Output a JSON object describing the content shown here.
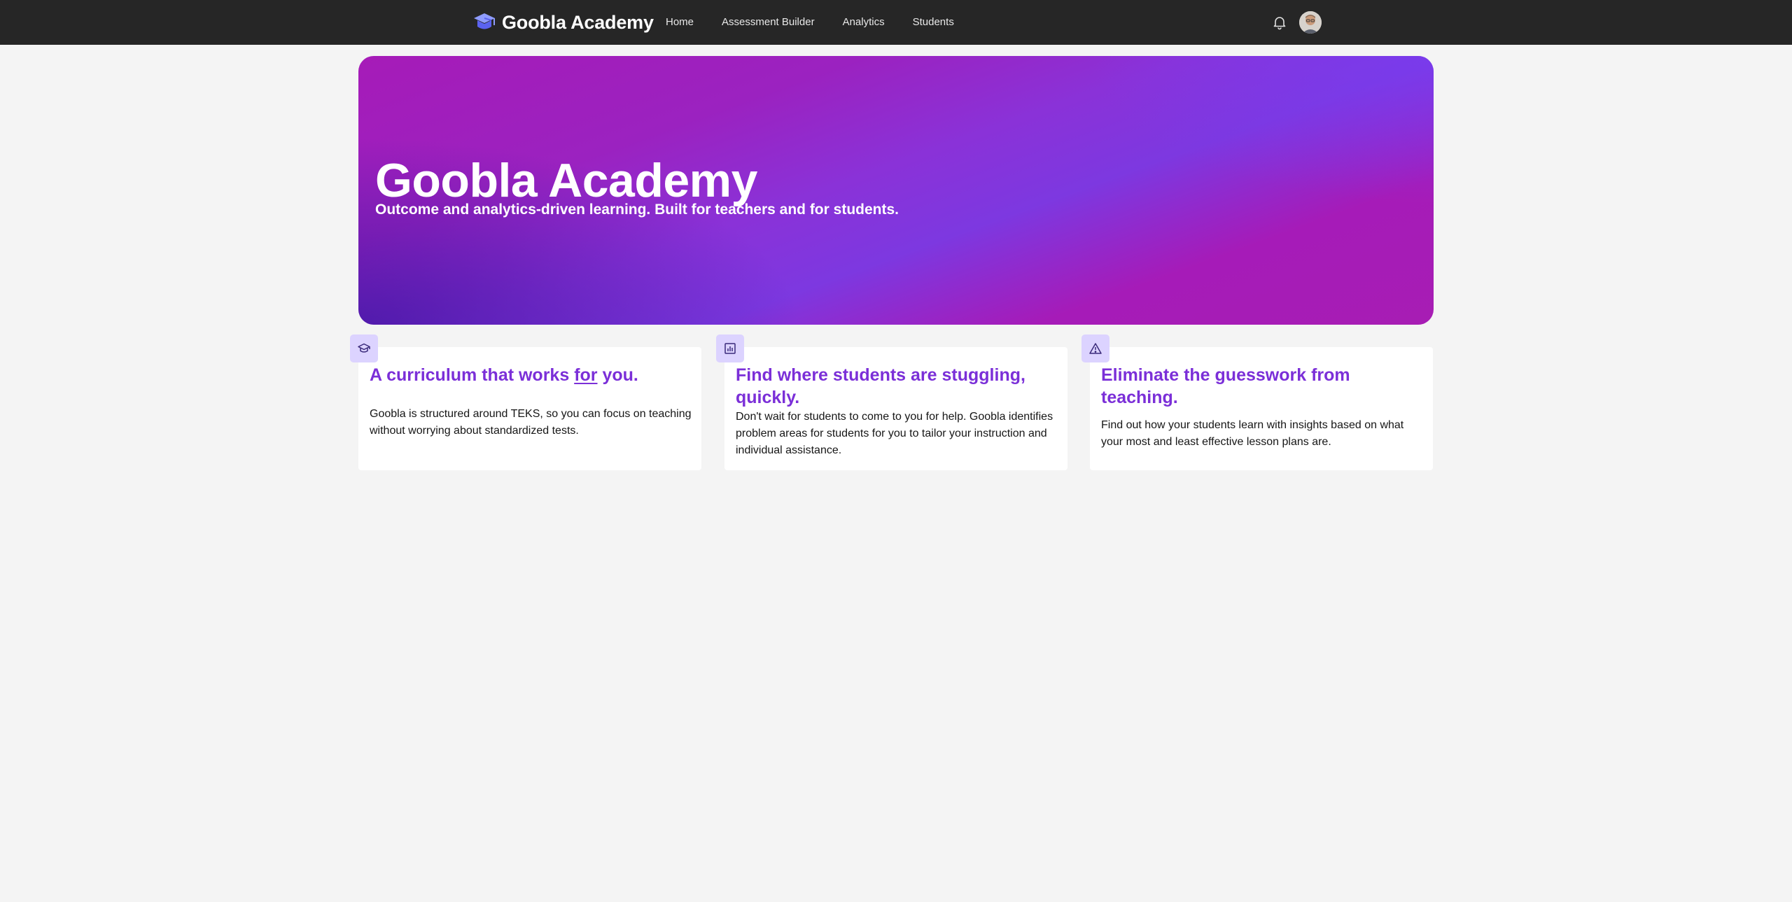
{
  "nav": {
    "brand_name": "Goobla Academy",
    "brand_icon": "graduation-cap-icon",
    "links": [
      "Home",
      "Assessment Builder",
      "Analytics",
      "Students"
    ],
    "notification_icon": "bell-icon",
    "avatar_icon": "user-avatar"
  },
  "hero": {
    "title": "Goobla Academy",
    "subtitle": "Outcome and analytics-driven learning. Built for teachers and for students."
  },
  "features": [
    {
      "icon": "graduation-cap-icon",
      "title_before": "A curriculum that works ",
      "title_emphasis": "for",
      "title_after": " you.",
      "body": "Goobla is structured around TEKS, so you can focus on teaching without worrying about standardized tests."
    },
    {
      "icon": "bar-chart-icon",
      "title": "Find where students are stuggling, quickly.",
      "body": "Don't wait for students to come to you for help. Goobla identifies problem areas for students for you to tailor your instruction and individual assistance."
    },
    {
      "icon": "warning-triangle-icon",
      "title": "Eliminate the guesswork from teaching.",
      "body": "Find out how your students learn with insights based on what your most and least effective lesson plans are."
    }
  ],
  "colors": {
    "topbar": "#262626",
    "page_background": "#f4f4f4",
    "accent_purple": "#7b2fd8",
    "badge_background": "#dcd3ff",
    "hero_magenta": "#a61bb8",
    "hero_violet": "#7d38e0"
  }
}
